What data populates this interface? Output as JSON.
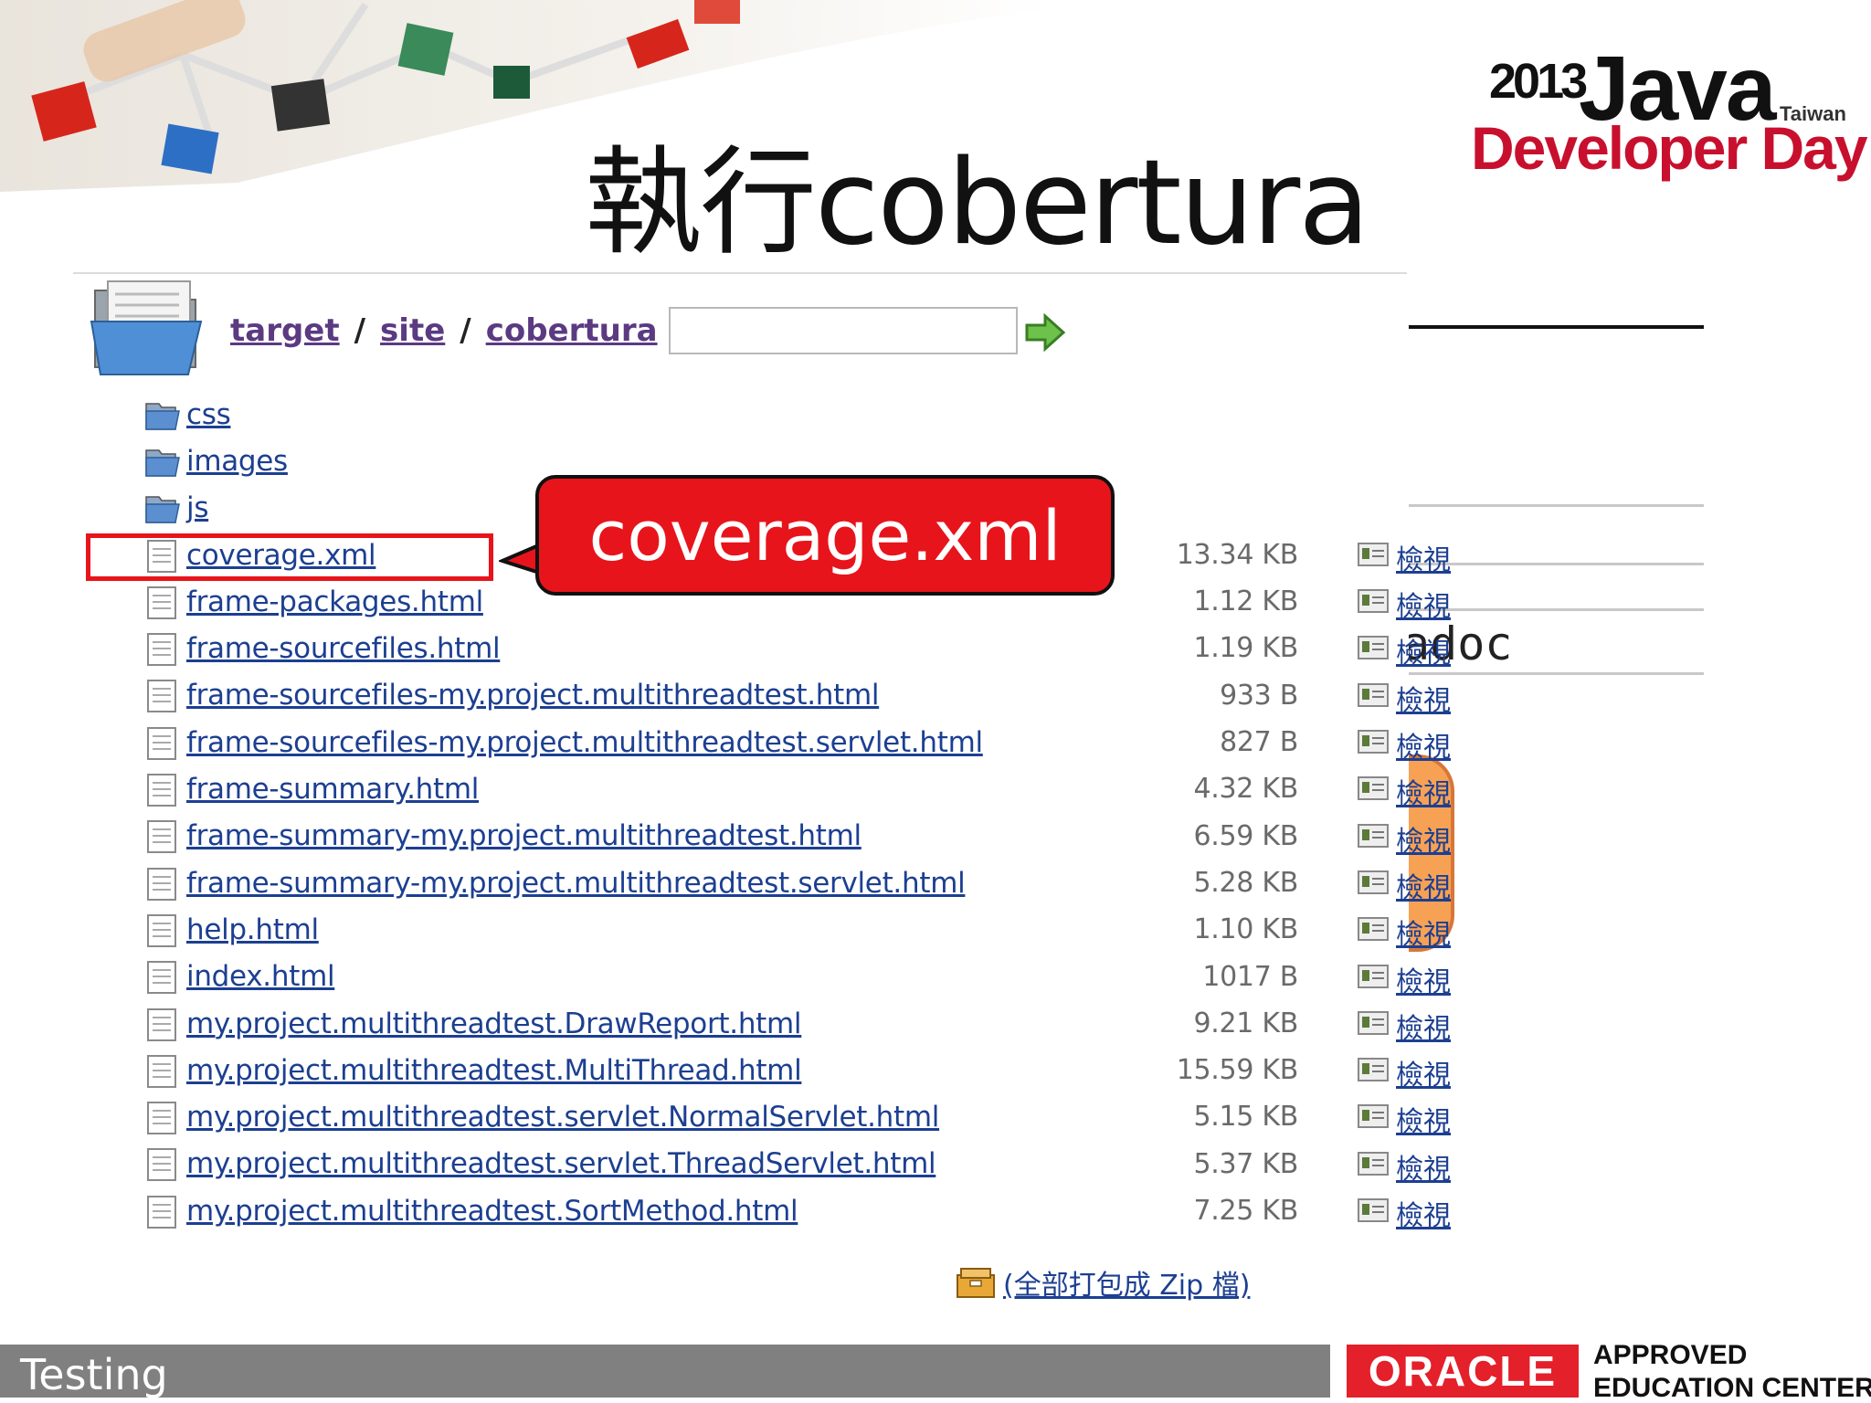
{
  "slide": {
    "title": "執行cobertura",
    "footer_label": "Testing"
  },
  "logo": {
    "year": "2013",
    "java": "Java",
    "region": "Taiwan",
    "event": "Developer Day"
  },
  "oracle": {
    "brand": "ORACLE",
    "line1": "APPROVED",
    "line2": "EDUCATION CENTER"
  },
  "background_fragment": {
    "text": "adoc"
  },
  "browser": {
    "breadcrumb": [
      "target",
      "site",
      "cobertura"
    ],
    "separator": "/",
    "path_input": {
      "value": "",
      "placeholder": ""
    },
    "go_icon": "green-arrow-icon",
    "folders": [
      {
        "name": "css"
      },
      {
        "name": "images"
      },
      {
        "name": "js"
      }
    ],
    "files": [
      {
        "name": "coverage.xml",
        "size": "13.34 KB",
        "action": "檢視"
      },
      {
        "name": "frame-packages.html",
        "size": "1.12 KB",
        "action": "檢視"
      },
      {
        "name": "frame-sourcefiles.html",
        "size": "1.19 KB",
        "action": "檢視"
      },
      {
        "name": "frame-sourcefiles-my.project.multithreadtest.html",
        "size": "933 B",
        "action": "檢視"
      },
      {
        "name": "frame-sourcefiles-my.project.multithreadtest.servlet.html",
        "size": "827 B",
        "action": "檢視"
      },
      {
        "name": "frame-summary.html",
        "size": "4.32 KB",
        "action": "檢視"
      },
      {
        "name": "frame-summary-my.project.multithreadtest.html",
        "size": "6.59 KB",
        "action": "檢視"
      },
      {
        "name": "frame-summary-my.project.multithreadtest.servlet.html",
        "size": "5.28 KB",
        "action": "檢視"
      },
      {
        "name": "help.html",
        "size": "1.10 KB",
        "action": "檢視"
      },
      {
        "name": "index.html",
        "size": "1017 B",
        "action": "檢視"
      },
      {
        "name": "my.project.multithreadtest.DrawReport.html",
        "size": "9.21 KB",
        "action": "檢視"
      },
      {
        "name": "my.project.multithreadtest.MultiThread.html",
        "size": "15.59 KB",
        "action": "檢視"
      },
      {
        "name": "my.project.multithreadtest.servlet.NormalServlet.html",
        "size": "5.15 KB",
        "action": "檢視"
      },
      {
        "name": "my.project.multithreadtest.servlet.ThreadServlet.html",
        "size": "5.37 KB",
        "action": "檢視"
      },
      {
        "name": "my.project.multithreadtest.SortMethod.html",
        "size": "7.25 KB",
        "action": "檢視"
      }
    ],
    "zip_link": "(全部打包成 Zip 檔)"
  },
  "callout": {
    "text": "coverage.xml"
  },
  "colors": {
    "link": "#1c3f91",
    "breadcrumb_link": "#5b3a82",
    "highlight": "#e8141b",
    "oracle_red": "#e4202a",
    "logo_red": "#c8102e",
    "footer_gray": "#808080"
  }
}
